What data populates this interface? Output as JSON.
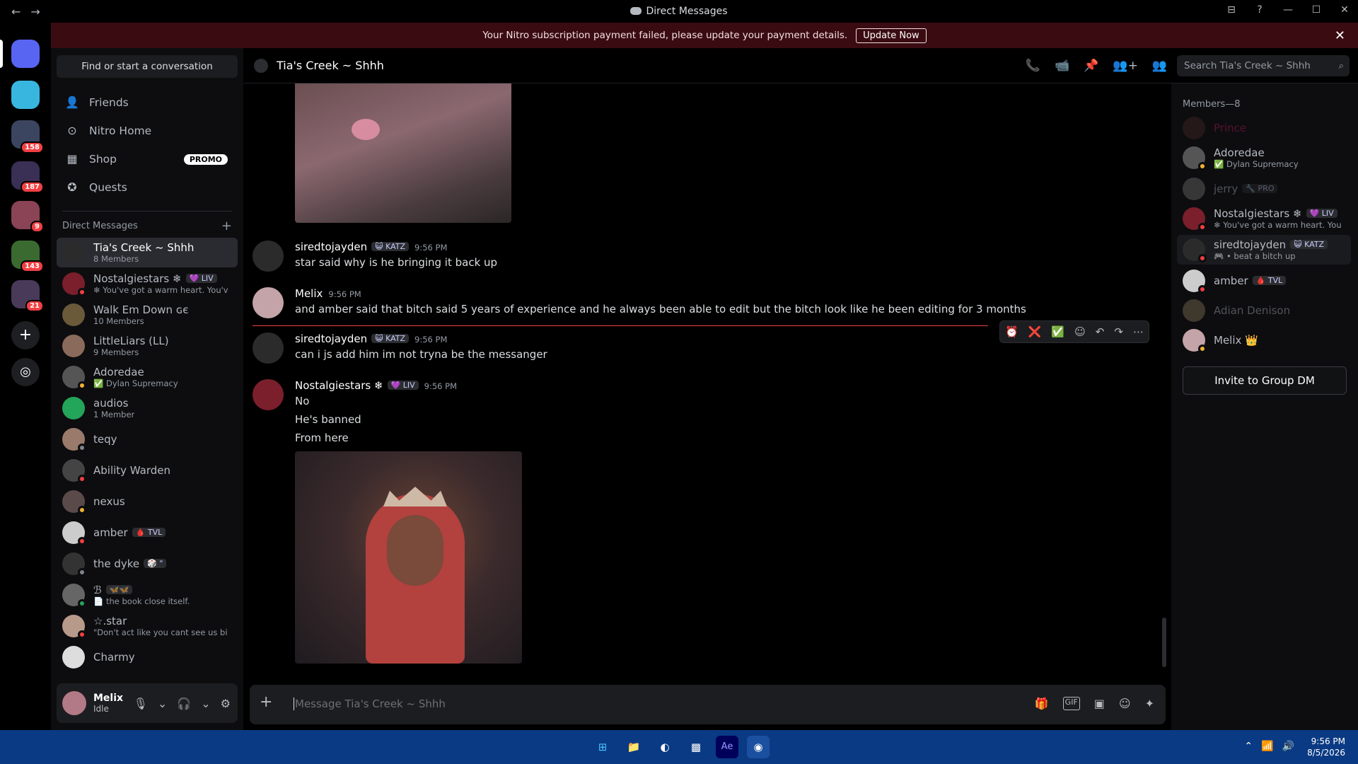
{
  "window": {
    "title": "Direct Messages",
    "nav_back": "←",
    "nav_fwd": "→",
    "win_controls": [
      "⊟",
      "?",
      "—",
      "☐",
      "✕"
    ]
  },
  "banner": {
    "text": "Your Nitro subscription payment failed, please update your payment details.",
    "button": "Update Now",
    "close": "✕"
  },
  "rail": {
    "badges": [
      "158",
      "187",
      "9",
      "143",
      "21"
    ],
    "add_icon": "+",
    "discover_icon": "◎"
  },
  "dm_sidebar": {
    "find_placeholder": "Find or start a conversation",
    "nav": [
      {
        "label": "Friends",
        "icon": "friends-icon",
        "glyph": "👤"
      },
      {
        "label": "Nitro Home",
        "icon": "nitro-icon",
        "glyph": "⊙"
      },
      {
        "label": "Shop",
        "icon": "shop-icon",
        "glyph": "▦",
        "promo": "PROMO"
      },
      {
        "label": "Quests",
        "icon": "quests-icon",
        "glyph": "✪"
      }
    ],
    "section_title": "Direct Messages",
    "add_dm": "+",
    "dms": [
      {
        "name": "Tia's Creek ~ Shhh",
        "sub": "8 Members"
      },
      {
        "name": "Nostalgiestars ❄",
        "tag": "💜 LIV",
        "sub": "❄ You've got a warm heart. You've ..."
      },
      {
        "name": "Walk Em Down ɢє",
        "sub": "10 Members"
      },
      {
        "name": "LittleLiars (LL)",
        "sub": "9 Members"
      },
      {
        "name": "Adoredae",
        "sub": "✅ Dylan Supremacy"
      },
      {
        "name": "audios",
        "sub": "1 Member"
      },
      {
        "name": "teqy",
        "sub": ""
      },
      {
        "name": "Ability Warden",
        "sub": ""
      },
      {
        "name": "nexus",
        "sub": ""
      },
      {
        "name": "amber",
        "tag": "🩸 TVL",
        "sub": ""
      },
      {
        "name": "the dyke",
        "tag": "🎲 \"",
        "sub": ""
      },
      {
        "name": "ℬ",
        "tag": "🦋🦋",
        "sub": "📄 the book close itself."
      },
      {
        "name": "☆.star",
        "sub": "\"Don't act like you cant see us bitch\""
      },
      {
        "name": "Charmy",
        "sub": ""
      }
    ]
  },
  "user": {
    "name": "Melix",
    "status": "Idle",
    "controls": [
      "🎙",
      "⌄",
      "🎧",
      "⌄",
      "⚙"
    ]
  },
  "chat": {
    "title": "Tia's Creek ~ Shhh",
    "header_icons": [
      "📞",
      "📹",
      "📌",
      "👥+",
      "👥"
    ],
    "search_placeholder": "Search Tia's Creek ~ Shhh",
    "search_icon": "⌕",
    "messages": [
      {
        "author": "siredtojayden",
        "tag": "😺 KATZ",
        "time": "9:56 PM",
        "lines": [
          "star said why is he bringing it back up"
        ]
      },
      {
        "author": "Melix",
        "time": "9:56 PM",
        "lines": [
          "and amber said that bitch said 5 years of experience and he always been able to edit but the bitch look like he been editing for 3 months"
        ]
      },
      {
        "author": "siredtojayden",
        "tag": "😺 KATZ",
        "time": "9:56 PM",
        "lines": [
          "can i js add him im not tryna be the messanger"
        ]
      },
      {
        "author": "Nostalgiestars ❄",
        "tag": "💜 LIV",
        "time": "9:56 PM",
        "lines": [
          "No",
          "He's banned",
          "From here"
        ]
      }
    ],
    "hover_actions": [
      "⏰",
      "❌",
      "✅",
      "☺",
      "↶",
      "↷",
      "⋯"
    ],
    "composer_placeholder": "Message Tia's Creek ~ Shhh",
    "composer_plus": "+",
    "composer_tools": [
      "🎁",
      "GIF",
      "▣",
      "☺",
      "✦"
    ]
  },
  "members": {
    "header": "Members—8",
    "list": [
      {
        "name": "Prince",
        "sub": "",
        "off": true
      },
      {
        "name": "Adoredae",
        "sub": "✅ Dylan Supremacy"
      },
      {
        "name": "jerry",
        "tag": "🔧 PRO",
        "sub": "",
        "off": true
      },
      {
        "name": "Nostalgiestars ❄",
        "tag": "💜 LIV",
        "sub": "❄ You've got a warm heart. You'v..."
      },
      {
        "name": "siredtojayden",
        "tag": "😺 KATZ",
        "sub": "🎮 • beat a bitch up"
      },
      {
        "name": "amber",
        "tag": "🩸 TVL",
        "sub": ""
      },
      {
        "name": "Adian Denison",
        "sub": "",
        "off": true
      },
      {
        "name": "Melix 👑",
        "sub": ""
      }
    ],
    "invite_button": "Invite to Group DM"
  },
  "taskbar": {
    "apps": [
      "⊞",
      "📁",
      "◐",
      "▩",
      "Ae",
      "◉"
    ],
    "tray": [
      "⌃",
      "📶",
      "🔊"
    ],
    "time": "9:56 PM",
    "date": "8/5/2026"
  },
  "colors": {
    "accent": "#5865f2",
    "banner_bg": "#3a0c12",
    "danger": "#f23f43",
    "online": "#23a55a",
    "idle": "#f0b232",
    "dnd": "#f23f43"
  }
}
